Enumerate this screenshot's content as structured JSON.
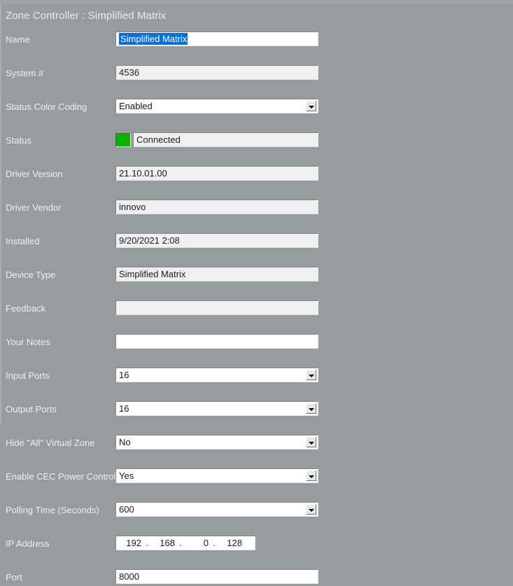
{
  "window": {
    "title": "Zone Controller : Simplified Matrix"
  },
  "colors": {
    "background": "#979c9f",
    "label_text": "#eef0f1",
    "readonly_field": "#f0f0f0",
    "editable_field": "#ffffff",
    "selection_blue": "#0b6fd8",
    "status_green": "#00b400"
  },
  "form": {
    "rows": [
      {
        "label": "Name",
        "type": "text-selected",
        "value": "Simplified Matrix",
        "editable": true,
        "name": "name"
      },
      {
        "label": "System #",
        "type": "text",
        "value": "4536",
        "editable": false,
        "name": "system-number"
      },
      {
        "label": "Status Color Coding",
        "type": "combo",
        "value": "Enabled",
        "editable": true,
        "name": "status-color-coding"
      },
      {
        "label": "Status",
        "type": "status",
        "value": "Connected",
        "swatch_color": "#00b400",
        "editable": false,
        "name": "status"
      },
      {
        "label": "Driver Version",
        "type": "text",
        "value": "21.10.01.00",
        "editable": false,
        "name": "driver-version"
      },
      {
        "label": "Driver Vendor",
        "type": "text",
        "value": "innovo",
        "editable": false,
        "name": "driver-vendor"
      },
      {
        "label": "Installed",
        "type": "text",
        "value": "9/20/2021 2:08",
        "editable": false,
        "name": "installed"
      },
      {
        "label": "Device Type",
        "type": "text",
        "value": "Simplified Matrix",
        "editable": false,
        "name": "device-type"
      },
      {
        "label": "Feedback",
        "type": "text",
        "value": "",
        "editable": false,
        "name": "feedback"
      },
      {
        "label": "Your Notes",
        "type": "text",
        "value": "",
        "editable": true,
        "name": "your-notes"
      },
      {
        "label": "Input Ports",
        "type": "combo",
        "value": "16",
        "editable": true,
        "name": "input-ports"
      },
      {
        "label": "Output Ports",
        "type": "combo",
        "value": "16",
        "editable": true,
        "name": "output-ports"
      },
      {
        "label": "Hide \"All\" Virtual Zone",
        "type": "combo",
        "value": "No",
        "editable": true,
        "name": "hide-all-virtual-zone"
      },
      {
        "label": "Enable CEC Power Control",
        "type": "combo",
        "value": "Yes",
        "editable": true,
        "name": "enable-cec-power-control"
      },
      {
        "label": "Polling Time (Seconds)",
        "type": "combo",
        "value": "600",
        "editable": true,
        "name": "polling-time-seconds"
      },
      {
        "label": "IP Address",
        "type": "ip",
        "octets": [
          "192",
          "168",
          "0",
          "128"
        ],
        "separator": ".",
        "editable": true,
        "name": "ip-address"
      },
      {
        "label": "Port",
        "type": "text",
        "value": "8000",
        "editable": true,
        "name": "port"
      }
    ]
  }
}
